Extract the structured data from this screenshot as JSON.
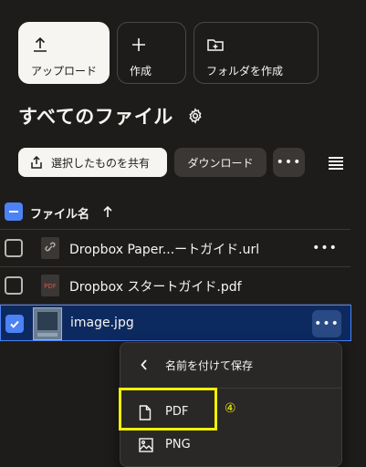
{
  "actions": {
    "upload": "アップロード",
    "create": "作成",
    "create_folder": "フォルダを作成"
  },
  "page_title": "すべてのファイル",
  "toolbar": {
    "share_label": "選択したものを共有",
    "download_label": "ダウンロード",
    "more_label": "•••"
  },
  "file_table": {
    "header_label": "ファイル名",
    "more_label": "•••",
    "rows": [
      {
        "name": "Dropbox Paper...ートガイド.url",
        "selected": false
      },
      {
        "name": "Dropbox スタートガイド.pdf",
        "selected": false
      },
      {
        "name": "image.jpg",
        "selected": true
      }
    ],
    "pdf_icon_text": "PDF"
  },
  "save_menu": {
    "back_label": "名前を付けて保存",
    "items": [
      "PDF",
      "PNG"
    ]
  },
  "annotation": {
    "step_marker": "④",
    "color": "#f2f000"
  },
  "colors": {
    "background": "#1e1c1a",
    "accent_blue": "#4d82f5",
    "selected_row": "#0d2a60"
  }
}
